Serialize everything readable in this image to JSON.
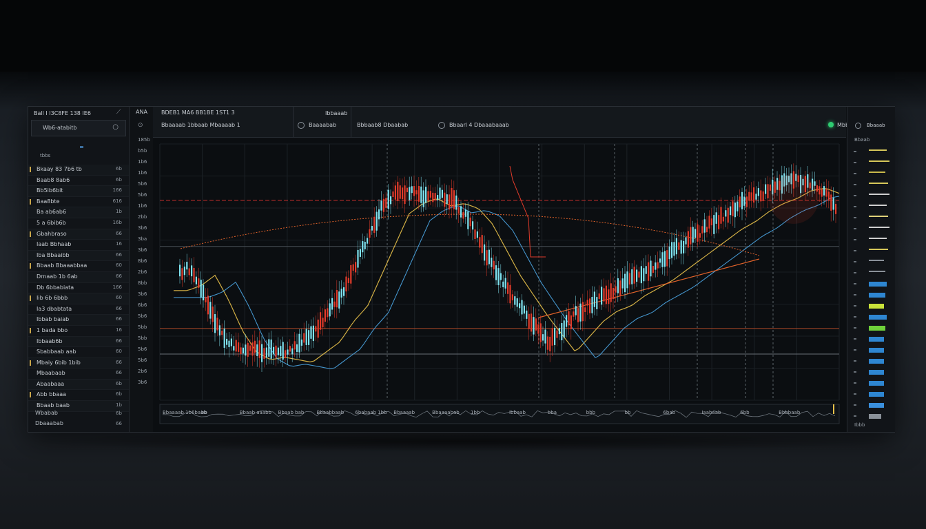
{
  "left_panel": {
    "title": "Ball I I3C8FE 138 IE6",
    "title_icon": "⟋",
    "search_label": "Wb6-atabitb",
    "search_icon": "○",
    "section": "tbbs",
    "rows": [
      {
        "label": "Bkaay 83 7b6 tb",
        "value": "6b"
      },
      {
        "label": "Baab8 8ab6",
        "value": "6b"
      },
      {
        "label": "Bb5ib6bit",
        "value": "166"
      },
      {
        "label": "Baa8bte",
        "value": "616"
      },
      {
        "label": "Ba ab6ab6",
        "value": "1b"
      },
      {
        "label": "5 a 6bib6b",
        "value": "16b"
      },
      {
        "label": "Gbahbraso",
        "value": "66"
      },
      {
        "label": "Iaab Bbhaab",
        "value": "16"
      },
      {
        "label": "Iba Bbaaibb",
        "value": "66"
      },
      {
        "label": "Bbaab Bbaaabbaa",
        "value": "60"
      },
      {
        "label": "Drnaab 1b 6ab",
        "value": "66"
      },
      {
        "label": "Db 6bbabiata",
        "value": "166"
      },
      {
        "label": "Iib 6b 6bbb",
        "value": "60"
      },
      {
        "label": "Ia3 dbabtata",
        "value": "66"
      },
      {
        "label": "Ibbab baiab",
        "value": "66"
      },
      {
        "label": "1 bada bbo",
        "value": "16"
      },
      {
        "label": "Ibbaab6b",
        "value": "66"
      },
      {
        "label": "Sbabbaab aab",
        "value": "60"
      },
      {
        "label": "Mbaiy 6bib 1bib",
        "value": "66"
      },
      {
        "label": "Mbaabaab",
        "value": "66"
      },
      {
        "label": "Abaabaaa",
        "value": "6b"
      },
      {
        "label": "Abb bbaaa",
        "value": "6b"
      },
      {
        "label": "Bbaab baab",
        "value": "1b"
      }
    ],
    "footer": [
      {
        "label": "Wbabab",
        "value": "6b"
      },
      {
        "label": "Dbaaabab",
        "value": "66"
      }
    ]
  },
  "axis_column": {
    "header": "ANA",
    "icon": "⊙",
    "labels": [
      "185b",
      "b5b",
      "1b6",
      "1b6",
      "5b6",
      "5b6",
      "1b6",
      "2bb",
      "3b6",
      "3ba",
      "3b6",
      "8b6",
      "2b6",
      "8bb",
      "3b6",
      "6b6",
      "5b6",
      "5bb",
      "5bb",
      "5b6",
      "5b6",
      "2b6",
      "3b6"
    ]
  },
  "toolbar": {
    "title": "BDEB1 MA6 BB1BE 1ST1 3",
    "subtitle": "Bbaaaab 1bbaab Mbaaaab 1",
    "badge": "Ibbaaab",
    "items": [
      {
        "label": "Baaaabab"
      },
      {
        "label": "Bbbaab8 Dbaabab"
      },
      {
        "label": "Bbaarl 4 Dbaaabaaab"
      }
    ],
    "live_label": "Mbb"
  },
  "chart_data": {
    "type": "candlestick",
    "title": "",
    "xlabel": "",
    "ylabel": "",
    "ylim": [
      0,
      100
    ],
    "grid": true,
    "series_colors": {
      "up": "#7fe3f0",
      "down": "#e23b2a",
      "ma_fast": "#e8c14a",
      "ma_slow": "#4aa3e0",
      "trend": "#e0622a",
      "level_line": "#c9302c"
    },
    "price_path": [
      [
        0,
        46
      ],
      [
        2,
        48
      ],
      [
        4,
        52
      ],
      [
        6,
        42
      ],
      [
        8,
        30
      ],
      [
        10,
        22
      ],
      [
        12,
        19
      ],
      [
        14,
        20
      ],
      [
        16,
        19
      ],
      [
        18,
        18
      ],
      [
        20,
        22
      ],
      [
        22,
        26
      ],
      [
        24,
        34
      ],
      [
        26,
        40
      ],
      [
        28,
        52
      ],
      [
        30,
        64
      ],
      [
        32,
        76
      ],
      [
        34,
        80
      ],
      [
        36,
        82
      ],
      [
        38,
        79
      ],
      [
        40,
        80
      ],
      [
        42,
        78
      ],
      [
        44,
        72
      ],
      [
        46,
        62
      ],
      [
        48,
        52
      ],
      [
        50,
        44
      ],
      [
        52,
        36
      ],
      [
        54,
        29
      ],
      [
        56,
        22
      ],
      [
        58,
        28
      ],
      [
        60,
        34
      ],
      [
        62,
        38
      ],
      [
        64,
        40
      ],
      [
        66,
        44
      ],
      [
        68,
        47
      ],
      [
        70,
        50
      ],
      [
        72,
        54
      ],
      [
        74,
        58
      ],
      [
        76,
        62
      ],
      [
        78,
        66
      ],
      [
        80,
        70
      ],
      [
        82,
        73
      ],
      [
        84,
        77
      ],
      [
        86,
        80
      ],
      [
        88,
        82
      ],
      [
        90,
        85
      ],
      [
        92,
        86
      ],
      [
        94,
        84
      ],
      [
        96,
        80
      ],
      [
        98,
        72
      ]
    ],
    "reference_levels": [
      78,
      60,
      28,
      18
    ]
  },
  "bottom_axis": {
    "labels": [
      "Bbaaaab 1b6baab",
      "bb",
      "Bbaab aaabb",
      "Bbaab bab",
      "Bbaabbaab",
      "6babaab 1bb",
      "Bbaaaab",
      "Bbaaaabab",
      "1bb",
      "Ibbaab",
      "bba",
      "bbb",
      "bb",
      "6bab",
      "Iaabaab",
      "6bb",
      "Bbbbaab"
    ]
  },
  "right_panel": {
    "icon_label": "Bbaaab",
    "sub_label": "Bbaab",
    "bottom_label": "Ibbb"
  }
}
